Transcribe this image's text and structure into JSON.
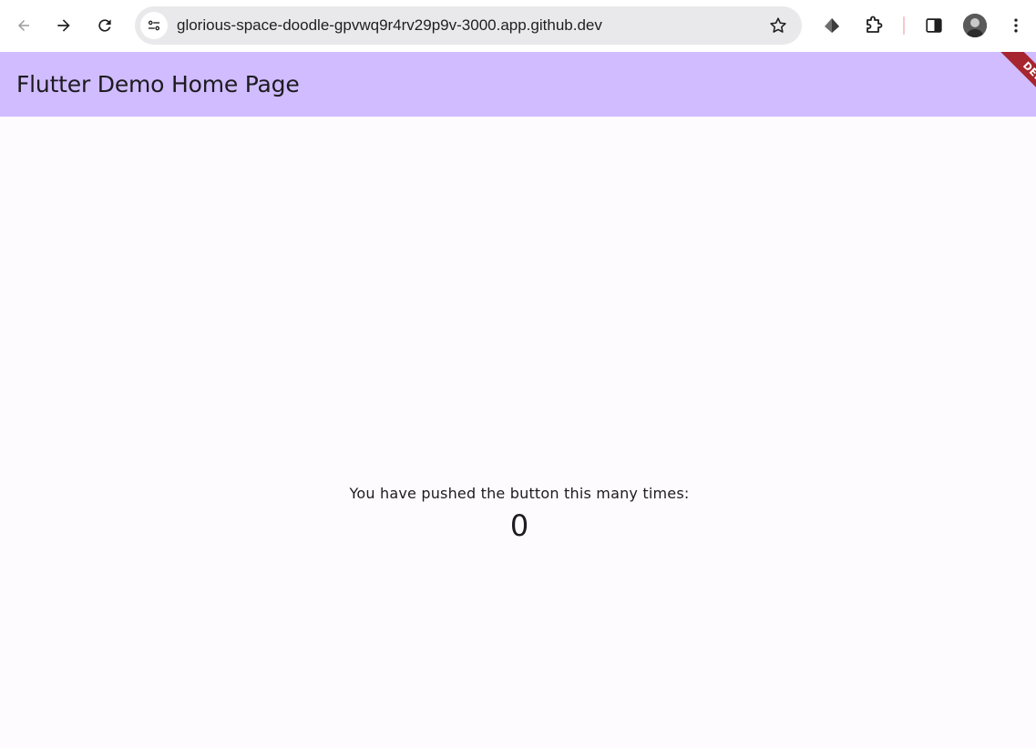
{
  "browser": {
    "url": "glorious-space-doodle-gpvwq9r4rv29p9v-3000.app.github.dev",
    "icons": {
      "back": "arrow-left-icon",
      "forward": "arrow-right-icon",
      "reload": "reload-icon",
      "site_info": "tune-icon",
      "bookmark": "star-icon",
      "extension_1": "extension-shield-icon",
      "extensions": "puzzle-icon",
      "side_panel": "side-panel-icon",
      "profile": "avatar",
      "menu": "kebab-menu-icon"
    }
  },
  "app": {
    "title": "Flutter Demo Home Page",
    "debug_banner": "DEBUG",
    "counter_label": "You have pushed the button this many times:",
    "counter_value": "0"
  },
  "colors": {
    "app_bar": "#d0bcff",
    "background": "#fefbff",
    "debug_ribbon": "#a6252e"
  }
}
